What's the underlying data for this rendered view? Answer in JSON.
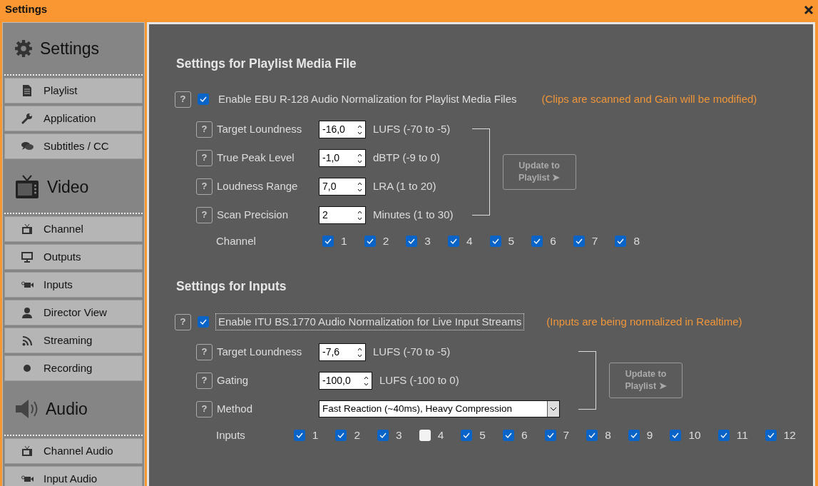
{
  "window": {
    "title": "Settings"
  },
  "sidebar": {
    "groups": [
      {
        "title": "Settings",
        "items": [
          {
            "label": "Playlist"
          },
          {
            "label": "Application"
          },
          {
            "label": "Subtitles / CC"
          }
        ]
      },
      {
        "title": "Video",
        "items": [
          {
            "label": "Channel"
          },
          {
            "label": "Outputs"
          },
          {
            "label": "Inputs"
          },
          {
            "label": "Director View"
          },
          {
            "label": "Streaming"
          },
          {
            "label": "Recording"
          }
        ]
      },
      {
        "title": "Audio",
        "items": [
          {
            "label": "Channel Audio"
          },
          {
            "label": "Input Audio"
          }
        ]
      }
    ]
  },
  "sections": [
    {
      "title": "Settings for Playlist Media File",
      "enable": {
        "help": "?",
        "checked": true,
        "focused": false,
        "label": "Enable EBU R-128 Audio Normalization for Playlist Media Files",
        "note": "(Clips are scanned and Gain will be modified)"
      },
      "fields": [
        {
          "kind": "spin",
          "help": "?",
          "label": "Target Loundness",
          "value": "-16,0",
          "unit": "LUFS (-70 to -5)"
        },
        {
          "kind": "spin",
          "help": "?",
          "label": "True Peak Level",
          "value": "-1,0",
          "unit": "dBTP (-9 to 0)"
        },
        {
          "kind": "spin",
          "help": "?",
          "label": "Loudness Range",
          "value": "7,0",
          "unit": "LRA (1 to 20)"
        },
        {
          "kind": "spin",
          "help": "?",
          "label": "Scan Precision",
          "value": "2",
          "unit": "Minutes (1 to 30)"
        }
      ],
      "update_button": {
        "label": "Update to Playlist ➤",
        "disabled": true
      },
      "checkboxes": {
        "label": "Channel",
        "items": [
          {
            "label": "1",
            "checked": true
          },
          {
            "label": "2",
            "checked": true
          },
          {
            "label": "3",
            "checked": true
          },
          {
            "label": "4",
            "checked": true
          },
          {
            "label": "5",
            "checked": true
          },
          {
            "label": "6",
            "checked": true
          },
          {
            "label": "7",
            "checked": true
          },
          {
            "label": "8",
            "checked": true
          }
        ]
      }
    },
    {
      "title": "Settings for Inputs",
      "enable": {
        "help": "?",
        "checked": true,
        "focused": true,
        "label": "Enable ITU BS.1770 Audio Normalization for Live Input Streams",
        "note": "(Inputs are being normalized in Realtime)"
      },
      "fields": [
        {
          "kind": "spin",
          "help": "?",
          "label": "Target Loundness",
          "value": "-7,6",
          "unit": "LUFS (-70 to -5)"
        },
        {
          "kind": "spin",
          "help": "?",
          "label": "Gating",
          "value": "-100,0",
          "unit": "LUFS (-100 to 0)"
        },
        {
          "kind": "select",
          "help": "?",
          "label": "Method",
          "value": "Fast Reaction (~40ms), Heavy Compression"
        }
      ],
      "update_button": {
        "label": "Update to Playlist ➤",
        "disabled": true
      },
      "checkboxes": {
        "label": "Inputs",
        "items": [
          {
            "label": "1",
            "checked": true
          },
          {
            "label": "2",
            "checked": true
          },
          {
            "label": "3",
            "checked": true
          },
          {
            "label": "4",
            "checked": false
          },
          {
            "label": "5",
            "checked": true
          },
          {
            "label": "6",
            "checked": true
          },
          {
            "label": "7",
            "checked": true
          },
          {
            "label": "8",
            "checked": true
          },
          {
            "label": "9",
            "checked": true
          },
          {
            "label": "10",
            "checked": true
          },
          {
            "label": "11",
            "checked": true
          },
          {
            "label": "12",
            "checked": true
          }
        ]
      }
    }
  ]
}
